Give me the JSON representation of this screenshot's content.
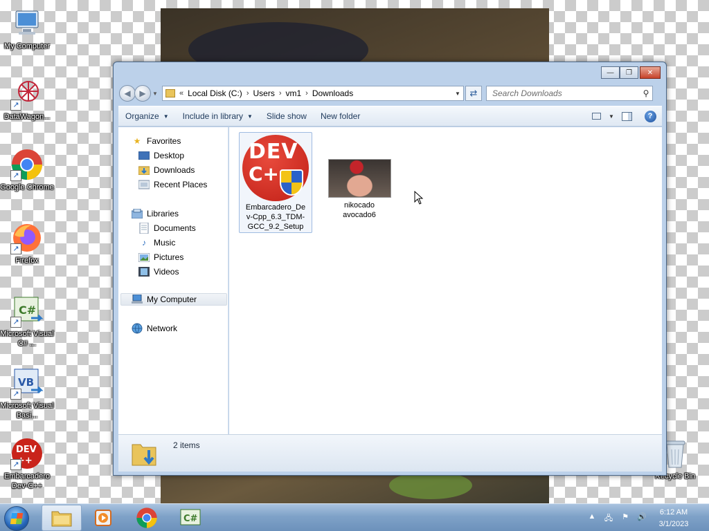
{
  "desktop": {
    "icons": [
      {
        "label": "My Computer"
      },
      {
        "label": "DataWagon..."
      },
      {
        "label": "Google Chrome"
      },
      {
        "label": "Firefox"
      },
      {
        "label": "Microsoft Visual C# ..."
      },
      {
        "label": "Microsoft Visual Basi..."
      },
      {
        "label": "Embarcadero Dev-C++"
      },
      {
        "label": "Recycle Bin"
      }
    ]
  },
  "window": {
    "title_buttons": {
      "minimize": "—",
      "maximize": "❐",
      "close": "✕"
    },
    "address": {
      "overflow": "«",
      "crumbs": [
        "Local Disk (C:)",
        "Users",
        "vm1",
        "Downloads"
      ]
    },
    "search": {
      "placeholder": "Search Downloads"
    },
    "commands": {
      "organize": "Organize",
      "include_in_library": "Include in library",
      "slide_show": "Slide show",
      "new_folder": "New folder"
    },
    "nav_pane": {
      "favorites": {
        "label": "Favorites",
        "items": [
          "Desktop",
          "Downloads",
          "Recent Places"
        ]
      },
      "libraries": {
        "label": "Libraries",
        "items": [
          "Documents",
          "Music",
          "Pictures",
          "Videos"
        ]
      },
      "computer": "My Computer",
      "network": "Network"
    },
    "files": [
      {
        "name": "Embarcadero_Dev-Cpp_6.3_TDM-GCC_9.2_Setup",
        "lines": [
          "Embarcadero_De",
          "v-Cpp_6.3_TDM-",
          "GCC_9.2_Setup"
        ],
        "icon_text": [
          "DEV",
          "C+"
        ]
      },
      {
        "name": "nikocado avocado6",
        "lines": [
          "nikocado",
          "avocado6"
        ]
      }
    ],
    "status": {
      "count": "2 items"
    }
  },
  "taskbar": {
    "clock": {
      "time": "6:12 AM",
      "date": "3/1/2023"
    },
    "pinned_icon_text": {
      "visual_csharp": "C#"
    }
  },
  "colors": {
    "accent": "#1e395b",
    "devcpp_red": "#c01f16",
    "window_frame": "#bcd1ea"
  }
}
